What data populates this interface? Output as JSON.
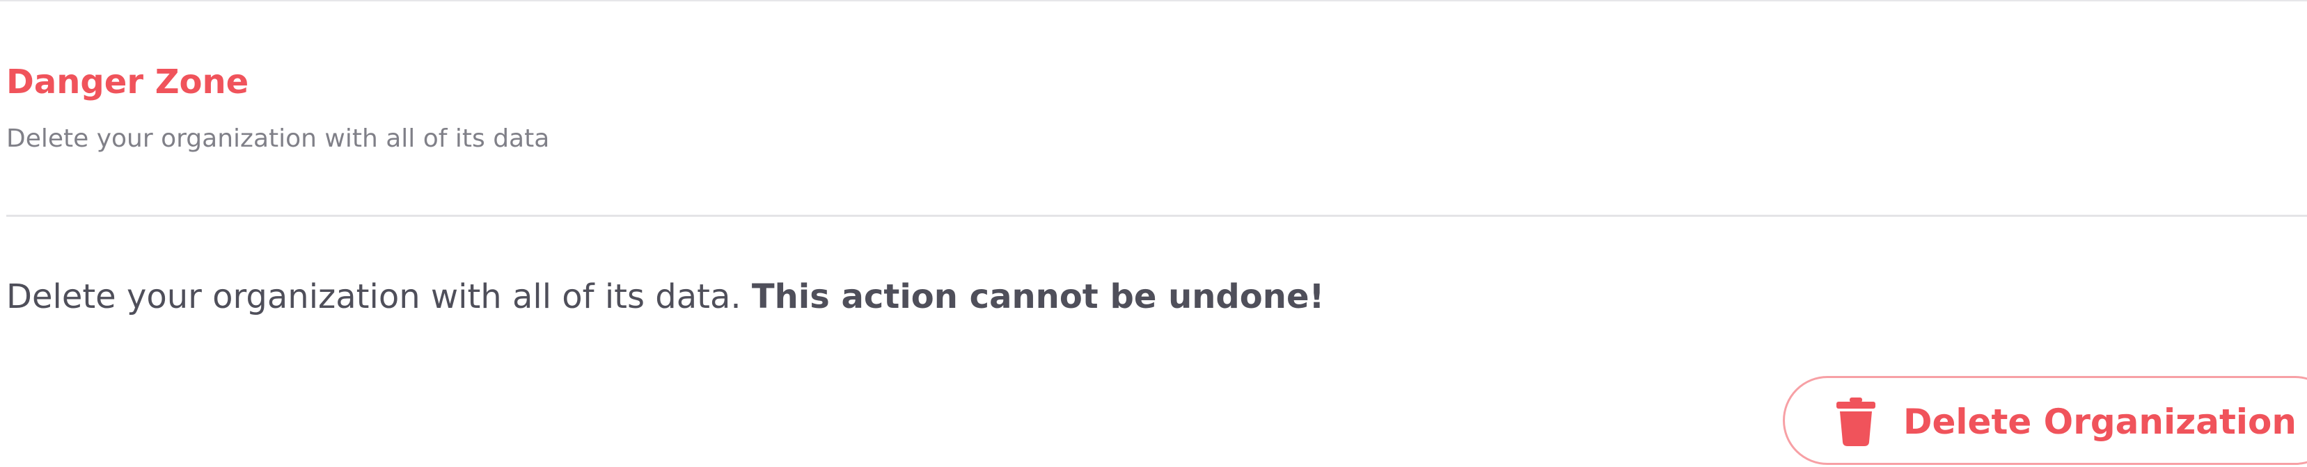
{
  "colors": {
    "danger": "#f0535b",
    "danger_border": "#f7a0a5",
    "muted_text": "#808088",
    "body_text": "#4f4f5a",
    "divider": "#e4e4e7"
  },
  "danger_zone": {
    "title": "Danger Zone",
    "subtitle": "Delete your organization with all of its data",
    "warning_text": "Delete your organization with all of its data.",
    "warning_emphasis": "This action cannot be undone!",
    "delete_button": {
      "label": "Delete Organization",
      "icon": "trash-icon"
    }
  }
}
